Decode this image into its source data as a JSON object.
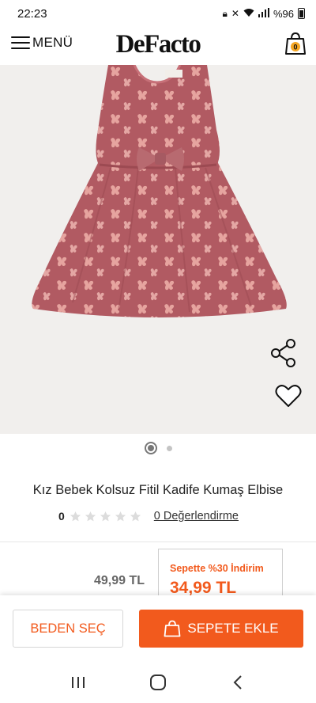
{
  "status_bar": {
    "time": "22:23",
    "battery": "%96",
    "icons": [
      "lock-icon",
      "mute-icon",
      "wifi-icon",
      "signal-icon",
      "battery-icon"
    ]
  },
  "header": {
    "menu_label": "MENÜ",
    "logo": "DeFacto",
    "cart_count": "0"
  },
  "product": {
    "title": "Kız Bebek Kolsuz Fitil Kadife Kumaş Elbise",
    "rating_value": "0",
    "stars_filled": 0,
    "stars_total": 5,
    "reviews_label": "0 Değerlendirme",
    "old_price": "49,99 TL",
    "promo_label": "Sepette %30 İndirim",
    "promo_price": "34,99 TL",
    "image_count": 2,
    "active_image": 1
  },
  "actions": {
    "size_label": "BEDEN SEÇ",
    "add_to_cart_label": "SEPETE EKLE"
  },
  "colors": {
    "accent": "#f25a1d",
    "dress": "#b15a62"
  }
}
